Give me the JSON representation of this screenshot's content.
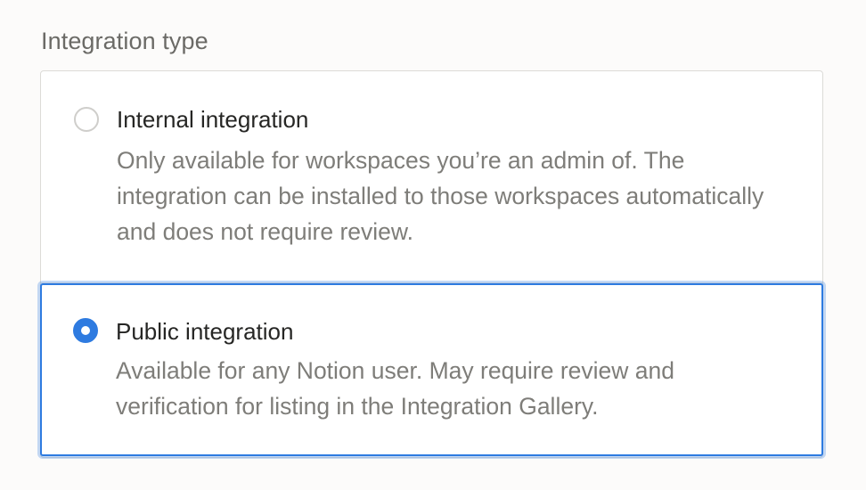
{
  "section": {
    "label": "Integration type"
  },
  "options": [
    {
      "title": "Internal integration",
      "description": "Only available for workspaces you’re an admin of. The integration can be installed to those workspaces automatically and does not require review.",
      "selected": false
    },
    {
      "title": "Public integration",
      "description": "Available for any Notion user. May require review and verification for listing in the Integration Gallery.",
      "selected": true
    }
  ],
  "colors": {
    "accent": "#2e7be0",
    "background": "#fcfbfa",
    "border": "#dcdbd7",
    "title_text": "#262624",
    "description_text": "#7e7d79"
  }
}
